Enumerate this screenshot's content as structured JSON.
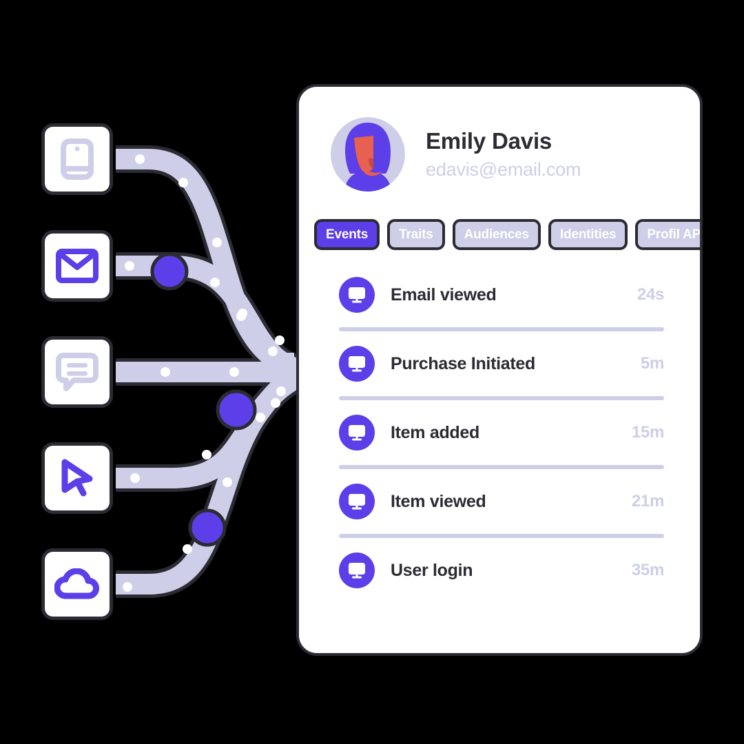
{
  "colors": {
    "accent_purple": "#5C3FE8",
    "lavender": "#CECEE8",
    "outline_dark": "#2B2B33",
    "card_bg": "#FFFFFF",
    "page_bg": "#000000",
    "face_coral": "#E8604F"
  },
  "sources": [
    {
      "id": "mobile",
      "icon": "mobile-phone-icon",
      "tone": "lavender"
    },
    {
      "id": "email",
      "icon": "envelope-icon",
      "tone": "purple"
    },
    {
      "id": "chat",
      "icon": "chat-bubble-icon",
      "tone": "lavender"
    },
    {
      "id": "cursor",
      "icon": "cursor-pointer-icon",
      "tone": "purple"
    },
    {
      "id": "cloud",
      "icon": "cloud-icon",
      "tone": "purple"
    }
  ],
  "profile": {
    "avatar_icon": "user-avatar-illustration",
    "name": "Emily Davis",
    "email": "edavis@email.com"
  },
  "tabs": [
    {
      "label": "Events",
      "active": true
    },
    {
      "label": "Traits",
      "active": false
    },
    {
      "label": "Audiences",
      "active": false
    },
    {
      "label": "Identities",
      "active": false
    },
    {
      "label": "Profil API",
      "active": false
    }
  ],
  "events": [
    {
      "icon": "monitor-icon",
      "label": "Email viewed",
      "time": "24s"
    },
    {
      "icon": "monitor-icon",
      "label": "Purchase Initiated",
      "time": "5m"
    },
    {
      "icon": "monitor-icon",
      "label": "Item added",
      "time": "15m"
    },
    {
      "icon": "monitor-icon",
      "label": "Item viewed",
      "time": "21m"
    },
    {
      "icon": "monitor-icon",
      "label": "User login",
      "time": "35m"
    }
  ]
}
